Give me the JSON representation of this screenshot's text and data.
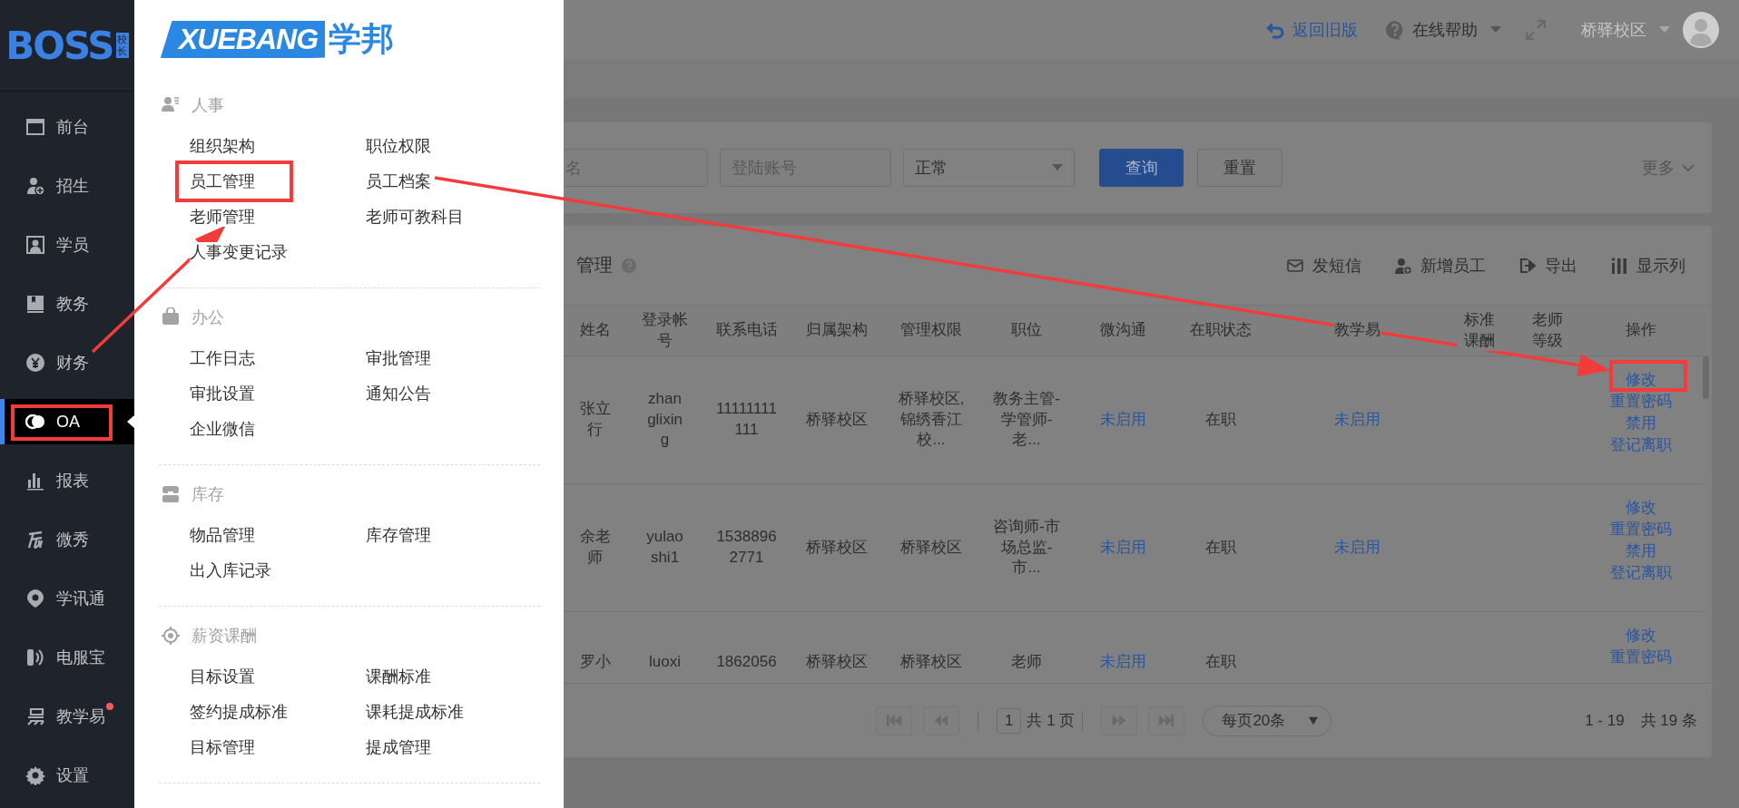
{
  "sidebar": {
    "logo": {
      "text": "BOSS",
      "tag": "校长"
    },
    "items": [
      {
        "label": "前台",
        "selected": false,
        "highlighted": false,
        "notification": false
      },
      {
        "label": "招生",
        "selected": false,
        "highlighted": false,
        "notification": false
      },
      {
        "label": "学员",
        "selected": false,
        "highlighted": false,
        "notification": false
      },
      {
        "label": "教务",
        "selected": false,
        "highlighted": false,
        "notification": false
      },
      {
        "label": "财务",
        "selected": false,
        "highlighted": false,
        "notification": false,
        "arrow_start": true
      },
      {
        "label": "OA",
        "selected": true,
        "highlighted": true,
        "notification": false
      },
      {
        "label": "报表",
        "selected": false,
        "highlighted": false,
        "notification": false
      },
      {
        "label": "微秀",
        "selected": false,
        "highlighted": false,
        "notification": false
      },
      {
        "label": "学讯通",
        "selected": false,
        "highlighted": false,
        "notification": false
      },
      {
        "label": "电服宝",
        "selected": false,
        "highlighted": false,
        "notification": false
      },
      {
        "label": "教学易",
        "selected": false,
        "highlighted": false,
        "notification": true
      },
      {
        "label": "设置",
        "selected": false,
        "highlighted": false,
        "notification": false
      }
    ]
  },
  "menu": {
    "logo_text": "XUEBANG",
    "logo_name": "学邦",
    "sections": [
      {
        "title": "人事",
        "items": [
          {
            "label": "组织架构",
            "highlighted": false
          },
          {
            "label": "职位权限",
            "highlighted": false
          },
          {
            "label": "员工管理",
            "highlighted": true
          },
          {
            "label": "员工档案",
            "highlighted": false,
            "arrow_start": true
          },
          {
            "label": "老师管理",
            "highlighted": false,
            "arrow_end": true
          },
          {
            "label": "老师可教科目",
            "highlighted": false
          },
          {
            "label": "人事变更记录",
            "highlighted": false
          }
        ]
      },
      {
        "title": "办公",
        "items": [
          {
            "label": "工作日志",
            "highlighted": false
          },
          {
            "label": "审批管理",
            "highlighted": false
          },
          {
            "label": "审批设置",
            "highlighted": false
          },
          {
            "label": "通知公告",
            "highlighted": false
          },
          {
            "label": "企业微信",
            "highlighted": false
          }
        ]
      },
      {
        "title": "库存",
        "items": [
          {
            "label": "物品管理",
            "highlighted": false
          },
          {
            "label": "库存管理",
            "highlighted": false
          },
          {
            "label": "出入库记录",
            "highlighted": false
          }
        ]
      },
      {
        "title": "薪资课酬",
        "items": [
          {
            "label": "目标设置",
            "highlighted": false
          },
          {
            "label": "课酬标准",
            "highlighted": false
          },
          {
            "label": "签约提成标准",
            "highlighted": false
          },
          {
            "label": "课耗提成标准",
            "highlighted": false
          },
          {
            "label": "目标管理",
            "highlighted": false
          },
          {
            "label": "提成管理",
            "highlighted": false
          }
        ]
      }
    ]
  },
  "top_bar": {
    "back_link": "返回旧版",
    "help": "在线帮助",
    "campus": "桥驿校区"
  },
  "filters": {
    "fields": [
      {
        "placeholder": "名"
      },
      {
        "placeholder": "登陆账号"
      }
    ],
    "status_select": "正常",
    "buttons": [
      {
        "label": "查询",
        "kind": "primary"
      },
      {
        "label": "重置",
        "kind": "default"
      }
    ],
    "more": "更多"
  },
  "table": {
    "title": "管理",
    "actions": [
      "发短信",
      "新增员工",
      "导出",
      "显示列"
    ],
    "columns": [
      {
        "label": "姓名",
        "kind": "text"
      },
      {
        "label": "登录帐号",
        "kind": "text"
      },
      {
        "label": "联系电话",
        "kind": "text"
      },
      {
        "label": "归属架构",
        "kind": "text"
      },
      {
        "label": "管理权限",
        "kind": "text"
      },
      {
        "label": "职位",
        "kind": "text"
      },
      {
        "label": "微沟通",
        "kind": "link"
      },
      {
        "label": "在职状态",
        "kind": "text"
      },
      {
        "label": "教学易",
        "kind": "link"
      },
      {
        "label": "标准课酬",
        "kind": "text"
      },
      {
        "label": "老师等级",
        "kind": "text"
      },
      {
        "label": "操作",
        "kind": "actions"
      }
    ],
    "rows": [
      {
        "cells": [
          "张立行",
          "zhanglixing",
          "11111111111",
          "桥驿校区",
          "桥驿校区,锦绣香江校...",
          "教务主管-学管师-老...",
          "未启用",
          "在职",
          "未启用"
        ],
        "actions": [
          {
            "label": "修改",
            "highlighted": true,
            "arrow_end": true
          },
          {
            "label": "重置密码",
            "highlighted": false
          },
          {
            "label": "禁用",
            "highlighted": false
          },
          {
            "label": "登记离职",
            "highlighted": false
          }
        ]
      },
      {
        "cells": [
          "余老师",
          "yulaoshi1",
          "15388962771",
          "桥驿校区",
          "桥驿校区",
          "咨询师-市场总监-市...",
          "未启用",
          "在职",
          "未启用"
        ],
        "actions": [
          {
            "label": "修改",
            "highlighted": false
          },
          {
            "label": "重置密码",
            "highlighted": false
          },
          {
            "label": "禁用",
            "highlighted": false
          },
          {
            "label": "登记离职",
            "highlighted": false
          }
        ]
      },
      {
        "cells": [
          "罗小",
          "luoxi",
          "1862056",
          "桥驿校区",
          "桥驿校区",
          "老师",
          "未启用",
          "在职"
        ],
        "actions": [
          {
            "label": "修改",
            "highlighted": false
          },
          {
            "label": "重置密码",
            "highlighted": false
          }
        ]
      }
    ]
  },
  "pagination": {
    "page": "1",
    "total_pages": "共 1 页",
    "page_size": "每页20条",
    "range": "1 - 19",
    "total": "共 19 条"
  }
}
